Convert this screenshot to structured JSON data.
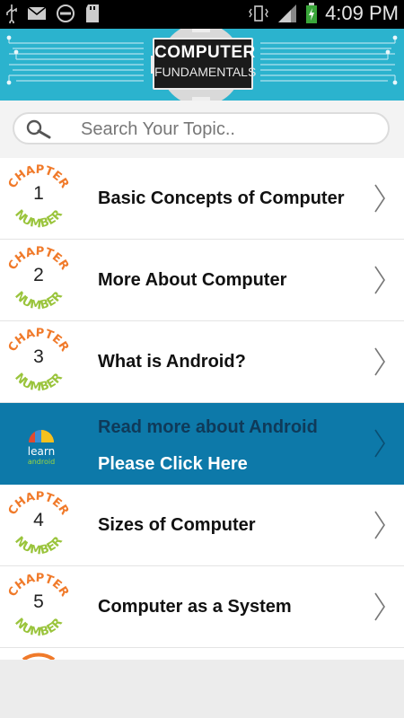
{
  "status_bar": {
    "time": "4:09 PM"
  },
  "header": {
    "logo_line1": "COMPUTER",
    "logo_line2": "FUNDAMENTALS"
  },
  "search": {
    "placeholder": "Search Your Topic.."
  },
  "badge_text": {
    "top": "CHAPTER",
    "bottom": "NUMBER"
  },
  "chapters": [
    {
      "number": "1",
      "title": "Basic Concepts of Computer"
    },
    {
      "number": "2",
      "title": "More About Computer"
    },
    {
      "number": "3",
      "title": "What is Android?"
    },
    {
      "number": "4",
      "title": "Sizes of Computer"
    },
    {
      "number": "5",
      "title": "Computer as a System"
    }
  ],
  "ad": {
    "line1": "Read more about Android",
    "line2": "Please Click Here",
    "icon_text1": "learn",
    "icon_text2": "android"
  },
  "colors": {
    "header_bg": "#2bb3ce",
    "ad_bg": "#0d79a9",
    "badge_orange": "#f07a2a",
    "badge_green": "#9ac43c"
  }
}
